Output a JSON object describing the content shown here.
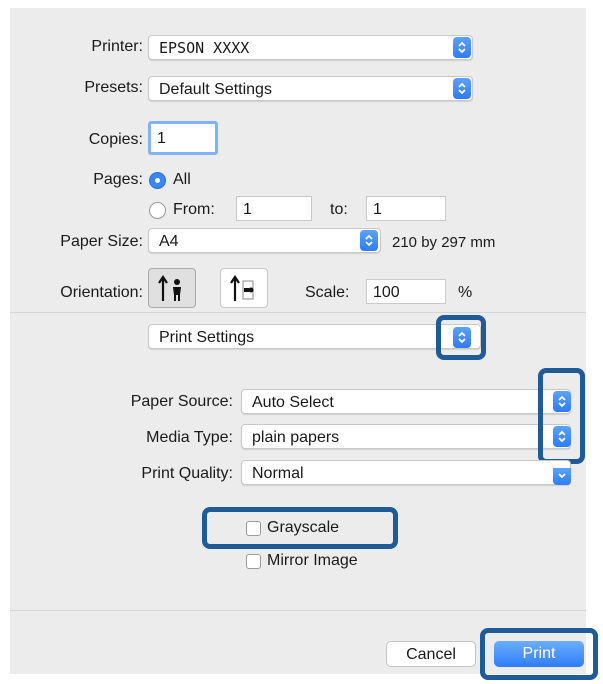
{
  "printer": {
    "label": "Printer:",
    "value": "EPSON XXXX"
  },
  "presets": {
    "label": "Presets:",
    "value": "Default Settings"
  },
  "copies": {
    "label": "Copies:",
    "value": "1"
  },
  "pages": {
    "label": "Pages:",
    "all_label": "All",
    "from_label": "From:",
    "from_value": "1",
    "to_label": "to:",
    "to_value": "1"
  },
  "paper_size": {
    "label": "Paper Size:",
    "value": "A4",
    "dimensions": "210 by 297 mm"
  },
  "orientation": {
    "label": "Orientation:"
  },
  "scale": {
    "label": "Scale:",
    "value": "100",
    "unit": "%"
  },
  "section": {
    "value": "Print Settings"
  },
  "paper_source": {
    "label": "Paper Source:",
    "value": "Auto Select"
  },
  "media_type": {
    "label": "Media Type:",
    "value": "plain papers"
  },
  "print_quality": {
    "label": "Print Quality:",
    "value": "Normal"
  },
  "grayscale": {
    "label": "Grayscale"
  },
  "mirror_image": {
    "label": "Mirror Image"
  },
  "buttons": {
    "cancel": "Cancel",
    "print": "Print"
  },
  "colors": {
    "accent": "#3a86f7",
    "highlight": "#1f5b99",
    "panel": "#ececec"
  }
}
